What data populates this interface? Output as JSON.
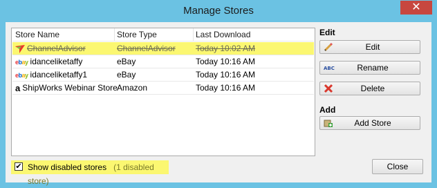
{
  "window": {
    "title": "Manage Stores",
    "close_glyph": "✕"
  },
  "table": {
    "headers": {
      "name": "Store Name",
      "type": "Store Type",
      "download": "Last Download"
    },
    "rows": [
      {
        "name": "ChannelAdvisor",
        "type": "ChannelAdvisor",
        "download": "Today 10:02 AM",
        "icon": "channeladvisor-icon",
        "disabled": true
      },
      {
        "name": "idanceliketaffy",
        "type": "eBay",
        "download": "Today 10:16 AM",
        "icon": "ebay-icon",
        "disabled": false
      },
      {
        "name": "idanceliketaffy1",
        "type": "eBay",
        "download": "Today 10:16 AM",
        "icon": "ebay-icon",
        "disabled": false
      },
      {
        "name": "ShipWorks Webinar Store",
        "type": "Amazon",
        "download": "Today 10:16 AM",
        "icon": "amazon-icon",
        "disabled": false
      }
    ]
  },
  "sidebar": {
    "edit_section": "Edit",
    "edit_button": "Edit",
    "rename_button": "Rename",
    "delete_button": "Delete",
    "add_section": "Add",
    "add_store_button": "Add Store"
  },
  "footer": {
    "show_disabled_label": "Show disabled stores",
    "show_disabled_checked": true,
    "disabled_count_note": "(1 disabled store)",
    "close_button": "Close"
  },
  "colors": {
    "highlight": "#fbf771",
    "titlebar": "#6bc2e3",
    "close": "#c7473f"
  }
}
